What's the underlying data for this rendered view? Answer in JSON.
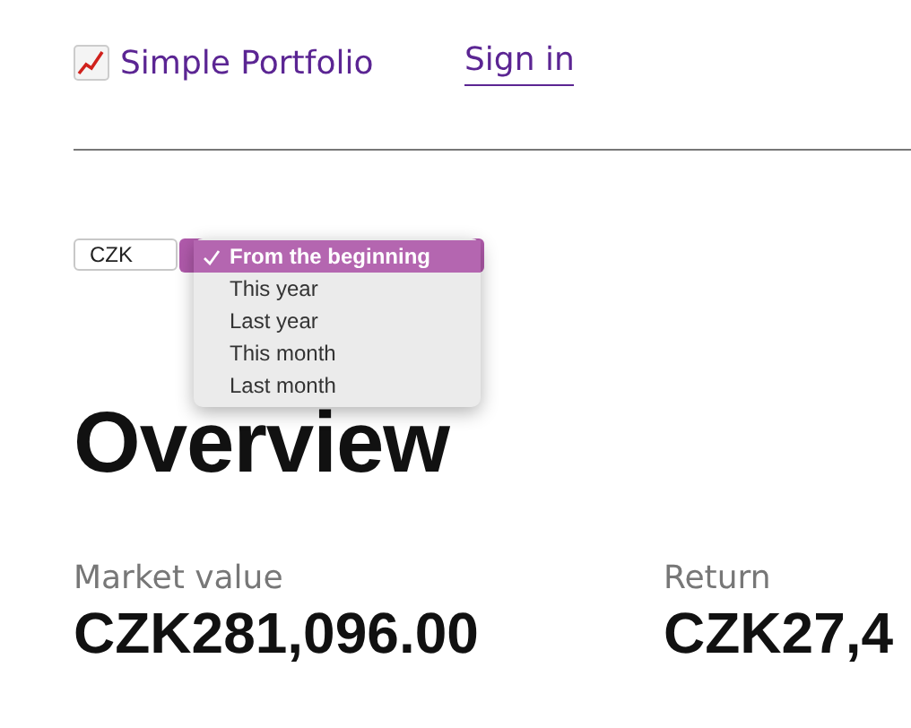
{
  "header": {
    "logo": "Simple Portfolio",
    "sign_in": "Sign in"
  },
  "currency_select": {
    "value": "CZK"
  },
  "period_menu": {
    "options": [
      {
        "label": "From the beginning",
        "selected": true
      },
      {
        "label": "This year",
        "selected": false
      },
      {
        "label": "Last year",
        "selected": false
      },
      {
        "label": "This month",
        "selected": false
      },
      {
        "label": "Last month",
        "selected": false
      }
    ]
  },
  "title": "Overview",
  "metrics": [
    {
      "label": "Market value",
      "value": "CZK281,096.00"
    },
    {
      "label": "Return",
      "value": "CZK27,4"
    }
  ]
}
